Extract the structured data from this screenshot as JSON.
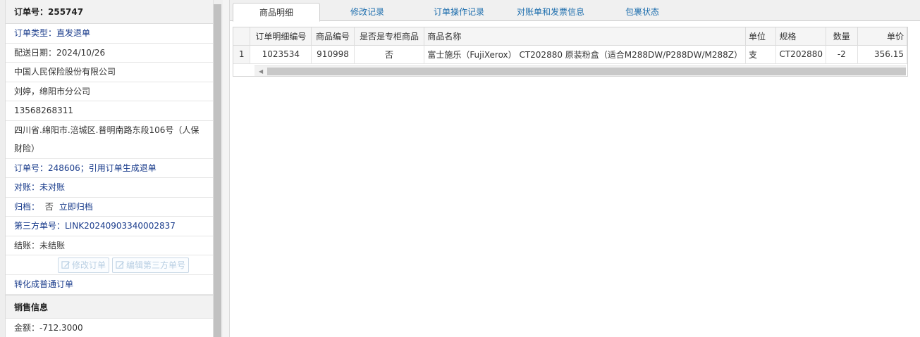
{
  "left_panel": {
    "order_title": "订单号：255747",
    "order_type": "订单类型：直发退单",
    "delivery_date": "配送日期：2024/10/26",
    "company": "中国人民保险股份有限公司",
    "contact": "刘婷，绵阳市分公司",
    "phone": "13568268311",
    "address": "四川省.绵阳市.涪城区.普明南路东段106号（人保财险）",
    "order_ref": "订单号：248606；引用订单生成退单",
    "reconcile": "对账：未对账",
    "archive_label": "归档：",
    "archive_value": "否",
    "archive_action": "立即归档",
    "third_party": "第三方单号：LINK20240903340002837",
    "settle": "结账：未结账",
    "btn_edit_order": "修改订单",
    "btn_edit_third": "编辑第三方单号",
    "convert": "转化成普通订单",
    "sales_header": "销售信息",
    "amount": "金额：-712.3000"
  },
  "tabs": [
    {
      "label": "商品明细",
      "active": true
    },
    {
      "label": "修改记录",
      "active": false
    },
    {
      "label": "订单操作记录",
      "active": false
    },
    {
      "label": "对账单和发票信息",
      "active": false
    },
    {
      "label": "包裹状态",
      "active": false
    }
  ],
  "grid": {
    "headers": [
      "",
      "订单明细编号",
      "商品编号",
      "是否是专柜商品",
      "商品名称",
      "单位",
      "规格",
      "数量",
      "单价"
    ],
    "rows": [
      {
        "rownum": "1",
        "detail_id": "1023534",
        "product_id": "910998",
        "is_counter": "否",
        "name": "富士施乐（FujiXerox） CT202880 原装粉盒（适合M288DW/P288DW/M288Z）",
        "unit": "支",
        "spec": "CT202880",
        "qty": "-2",
        "price": "356.15"
      }
    ]
  },
  "colors": {
    "link": "#1a3c8c",
    "tab_link": "#1f6fae",
    "disabled_button": "#b9cfe3"
  }
}
